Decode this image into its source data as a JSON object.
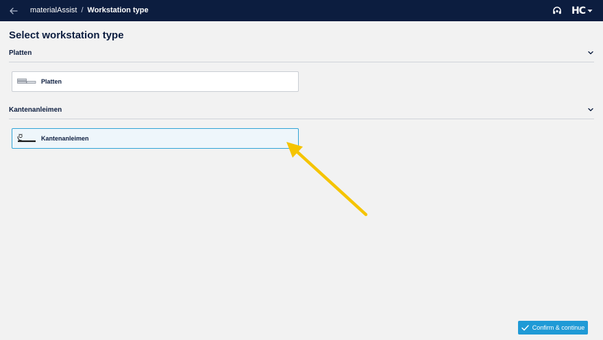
{
  "header": {
    "breadcrumb_app": "materialAssist",
    "breadcrumb_separator": "/",
    "breadcrumb_current": "Workstation type",
    "brand_logo": "HC",
    "icons": [
      "back-arrow-icon",
      "help-headset-icon",
      "caret-down-icon"
    ]
  },
  "page": {
    "title": "Select workstation type"
  },
  "sections": [
    {
      "title": "Platten",
      "expanded": true,
      "options": [
        {
          "label": "Platten",
          "icon": "panel-stack-icon",
          "selected": false
        }
      ]
    },
    {
      "title": "Kantenanleimen",
      "expanded": true,
      "options": [
        {
          "label": "Kantenanleimen",
          "icon": "edge-banding-icon",
          "selected": true
        }
      ]
    }
  ],
  "footer": {
    "confirm_label": "Confirm & continue",
    "confirm_icon": "check-icon"
  },
  "colors": {
    "topbar": "#0c1d3f",
    "background": "#f2f2f2",
    "accent": "#1f9ad6",
    "selected_border": "#2fa3d6",
    "annotation_arrow": "#f5c400"
  }
}
